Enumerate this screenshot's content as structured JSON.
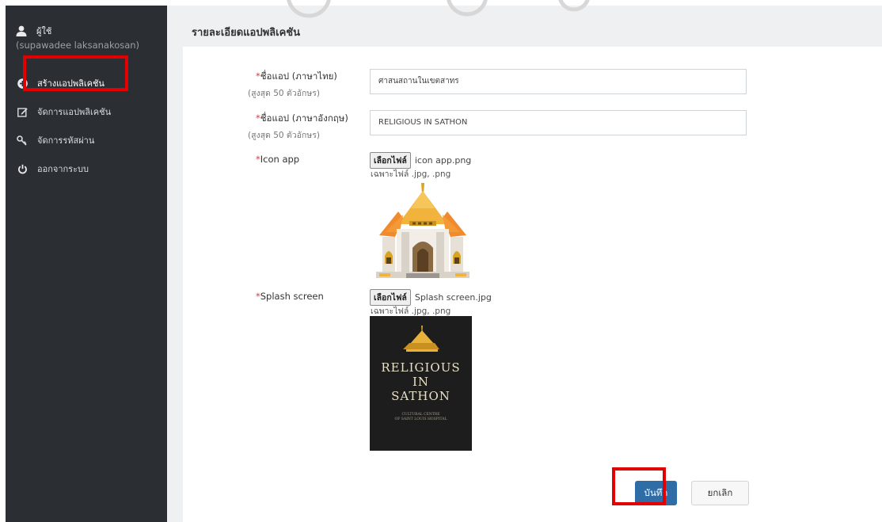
{
  "sidebar": {
    "user_label": "ผู้ใช้",
    "user_name": "(supawadee laksanakosan)",
    "items": [
      {
        "label": "สร้างแอปพลิเคชัน",
        "icon": "plus-circle-icon"
      },
      {
        "label": "จัดการแอปพลิเคชัน",
        "icon": "edit-icon"
      },
      {
        "label": "จัดการรหัสผ่าน",
        "icon": "key-icon"
      },
      {
        "label": "ออกจากระบบ",
        "icon": "power-icon"
      }
    ]
  },
  "main": {
    "title": "รายละเอียดแอปพลิเคชัน",
    "fields": {
      "app_name_th_label": "ชื่อแอป (ภาษาไทย)",
      "app_name_th_hint": "(สูงสุด 50 ตัวอักษร)",
      "app_name_th_value": "ศาสนสถานในเขตสาทร",
      "app_name_en_label": "ชื่อแอป (ภาษาอังกฤษ)",
      "app_name_en_hint": "(สูงสุด 50 ตัวอักษร)",
      "app_name_en_value": "RELIGIOUS IN SATHON",
      "icon_label": "Icon app",
      "icon_btn": "เลือกไฟล์",
      "icon_file": "icon app.png",
      "icon_note": "เฉพาะไฟล์ .jpg, .png",
      "splash_label": "Splash screen",
      "splash_btn": "เลือกไฟล์",
      "splash_file": "Splash screen.jpg",
      "splash_note": "เฉพาะไฟล์ .jpg, .png",
      "required_mark": "*"
    },
    "splash_preview": {
      "line1": "RELIGIOUS",
      "line2": "IN",
      "line3": "SATHON",
      "small1": "CULTURAL CENTRE",
      "small2": "OF SAINT LOUIS HOSPITAL"
    },
    "buttons": {
      "save": "บันทึก",
      "cancel": "ยกเลิก"
    }
  },
  "colors": {
    "sidebar_bg": "#2b2f33",
    "primary": "#2f6da6",
    "highlight": "#e30000",
    "required": "#e2353b"
  }
}
